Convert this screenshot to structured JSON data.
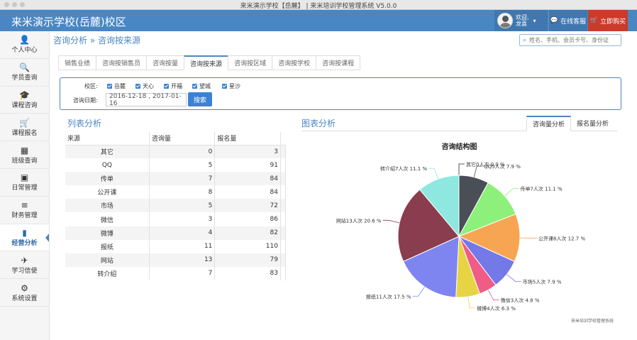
{
  "window": {
    "title": "来米演示学校【岳麓】 | 来米培训学校管理系统 V5.0.0"
  },
  "header": {
    "school_name": "来米演示学校(岳麓)校区",
    "welcome_line1": "欢迎,",
    "welcome_line2": "龙喜",
    "service_label": "在线客服",
    "buy_label": "立即购买"
  },
  "sidebar": {
    "items": [
      {
        "label": "个人中心",
        "icon": "user-icon",
        "glyph": "👤"
      },
      {
        "label": "学员查询",
        "icon": "search-icon",
        "glyph": "🔍"
      },
      {
        "label": "课程咨询",
        "icon": "graduation-cap-icon",
        "glyph": "🎓"
      },
      {
        "label": "课程报名",
        "icon": "cart-icon",
        "glyph": "🛒"
      },
      {
        "label": "班级查询",
        "icon": "cubes-icon",
        "glyph": "▦"
      },
      {
        "label": "日常管理",
        "icon": "calendar-icon",
        "glyph": "▣"
      },
      {
        "label": "财务管理",
        "icon": "menu-icon",
        "glyph": "≡"
      },
      {
        "label": "经营分析",
        "icon": "bar-chart-icon",
        "glyph": "▮"
      },
      {
        "label": "学习信使",
        "icon": "send-icon",
        "glyph": "✈"
      },
      {
        "label": "系统设置",
        "icon": "gears-icon",
        "glyph": "⚙"
      }
    ],
    "active_index": 7
  },
  "breadcrumb": {
    "part1": "咨询分析",
    "sep": "»",
    "part2": "咨询按来源"
  },
  "search": {
    "placeholder": "姓名、手机、会员卡号、身份证"
  },
  "tabs": [
    "销售业绩",
    "咨询按销售员",
    "咨询按量",
    "咨询按来源",
    "咨询按区域",
    "咨询按学校",
    "咨询按课程"
  ],
  "active_tab": 3,
  "filter": {
    "campus_label": "校区:",
    "campuses": [
      "岳麓",
      "天心",
      "开福",
      "望城",
      "星沙"
    ],
    "date_label": "咨询日期:",
    "date_value": "2016-12-18 , 2017-01-16",
    "search_label": "搜索"
  },
  "list": {
    "title": "列表分析",
    "headers": [
      "来源",
      "咨询量",
      "报名量"
    ],
    "rows": [
      [
        "其它",
        "0",
        "3"
      ],
      [
        "QQ",
        "5",
        "91"
      ],
      [
        "传单",
        "7",
        "84"
      ],
      [
        "公开课",
        "8",
        "84"
      ],
      [
        "市场",
        "5",
        "72"
      ],
      [
        "微信",
        "3",
        "86"
      ],
      [
        "微博",
        "4",
        "82"
      ],
      [
        "报纸",
        "11",
        "110"
      ],
      [
        "网站",
        "13",
        "79"
      ],
      [
        "转介绍",
        "7",
        "83"
      ]
    ]
  },
  "chart_section": {
    "title": "图表分析",
    "tab_active": "咨询量分析",
    "tab_other": "报名量分析",
    "footer": "来米培训学校管理系统"
  },
  "chart_data": {
    "type": "pie",
    "title": "咨询结构图",
    "slices": [
      {
        "name": "其它",
        "value": 0,
        "label": "其它0人次 0.0 %",
        "color": "#2b2b2b"
      },
      {
        "name": "QQ",
        "value": 5,
        "label": "QQ5人次 7.9 %",
        "color": "#4a4e57"
      },
      {
        "name": "传单",
        "value": 7,
        "label": "传单7人次 11.1 %",
        "color": "#8df07a"
      },
      {
        "name": "公开课",
        "value": 8,
        "label": "公开课8人次 12.7 %",
        "color": "#f7a552"
      },
      {
        "name": "市场",
        "value": 5,
        "label": "市场5人次 7.9 %",
        "color": "#7479e8"
      },
      {
        "name": "微信",
        "value": 3,
        "label": "微信3人次 4.8 %",
        "color": "#ef5c86"
      },
      {
        "name": "微博",
        "value": 4,
        "label": "微博4人次 6.3 %",
        "color": "#e6d444"
      },
      {
        "name": "报纸",
        "value": 11,
        "label": "报纸11人次 17.5 %",
        "color": "#7f85f0"
      },
      {
        "name": "网站",
        "value": 13,
        "label": "网站13人次 20.6 %",
        "color": "#8a3d4e"
      },
      {
        "name": "转介绍",
        "value": 7,
        "label": "转介绍7人次 11.1 %",
        "color": "#8ee8e0"
      }
    ]
  }
}
